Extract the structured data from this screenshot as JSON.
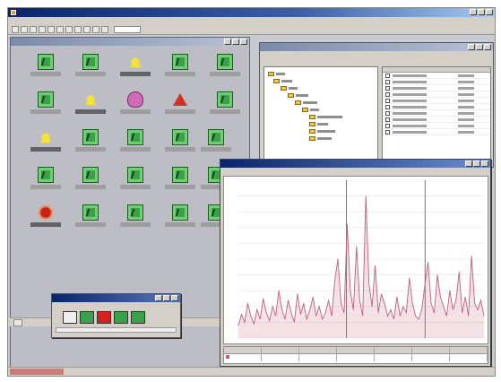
{
  "app": {
    "accent": "#0a246a"
  },
  "map": {
    "nodes": [
      {
        "type": "green"
      },
      {
        "type": "green"
      },
      {
        "type": "yellow"
      },
      {
        "type": "green"
      },
      {
        "type": "green"
      },
      {
        "type": "green"
      },
      {
        "type": "yellow"
      },
      {
        "type": "pink"
      },
      {
        "type": "redtri"
      },
      {
        "type": "green"
      },
      {
        "type": "yellow"
      },
      {
        "type": "green"
      },
      {
        "type": "green"
      },
      {
        "type": "green"
      },
      {
        "type": "part"
      },
      {
        "type": "green"
      },
      {
        "type": "green"
      },
      {
        "type": "green"
      },
      {
        "type": "green"
      },
      {
        "type": "part"
      },
      {
        "type": "red"
      },
      {
        "type": "green"
      },
      {
        "type": "green"
      },
      {
        "type": "green"
      },
      {
        "type": "part"
      }
    ],
    "colors": {
      "ok": "#3aa04a",
      "warning": "#f3e23a",
      "critical": "#c92020",
      "unknown": "#d26bb6"
    }
  },
  "chart_data": {
    "type": "line",
    "color": "#c0607a",
    "grid": true,
    "ylim": [
      0,
      100
    ],
    "x": [
      0,
      1,
      2,
      3,
      4,
      5,
      6,
      7,
      8,
      9,
      10,
      11,
      12,
      13,
      14,
      15,
      16,
      17,
      18,
      19,
      20,
      21,
      22,
      23,
      24,
      25,
      26,
      27,
      28,
      29,
      30,
      31,
      32,
      33,
      34,
      35,
      36,
      37,
      38,
      39,
      40,
      41,
      42,
      43,
      44,
      45,
      46,
      47,
      48,
      49,
      50,
      51,
      52,
      53,
      54,
      55,
      56,
      57,
      58,
      59,
      60,
      61,
      62,
      63,
      64,
      65,
      66,
      67,
      68,
      69,
      70,
      71,
      72,
      73,
      74,
      75,
      76,
      77,
      78,
      79
    ],
    "series": [
      {
        "values": [
          8,
          15,
          10,
          22,
          14,
          9,
          18,
          12,
          25,
          16,
          11,
          20,
          14,
          30,
          18,
          12,
          24,
          16,
          10,
          28,
          15,
          22,
          12,
          18,
          26,
          14,
          20,
          12,
          16,
          24,
          14,
          36,
          50,
          22,
          16,
          72,
          30,
          18,
          58,
          24,
          14,
          90,
          34,
          20,
          46,
          16,
          28,
          22,
          14,
          18,
          12,
          26,
          14,
          20,
          16,
          38,
          22,
          14,
          12,
          18,
          34,
          48,
          22,
          16,
          40,
          26,
          20,
          14,
          30,
          18,
          24,
          42,
          16,
          26,
          14,
          52,
          22,
          18,
          24,
          14
        ]
      }
    ]
  }
}
